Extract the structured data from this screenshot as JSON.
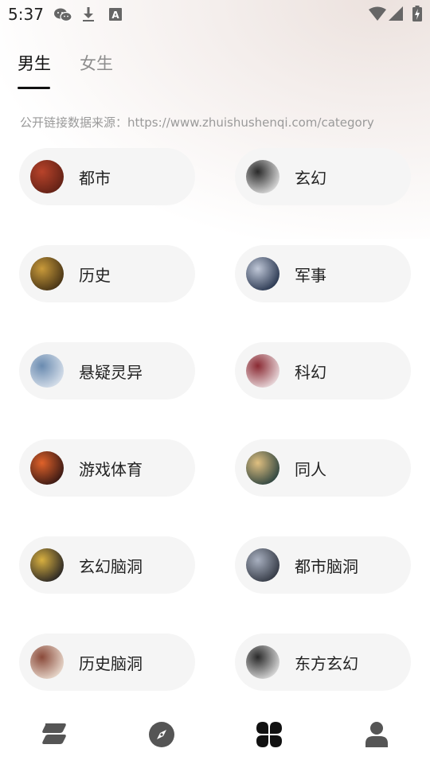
{
  "status_bar": {
    "time": "5:37",
    "icons": [
      "wechat-icon",
      "download-icon",
      "font-a-icon",
      "wifi-icon",
      "signal-icon",
      "battery-charging-icon"
    ]
  },
  "tabs": [
    {
      "label": "男生",
      "active": true
    },
    {
      "label": "女生",
      "active": false
    }
  ],
  "source_text": "公开链接数据来源：https://www.zhuishushenqi.com/category",
  "categories": [
    {
      "label": "都市",
      "thumb": [
        "#5a1e14",
        "#b8432a"
      ]
    },
    {
      "label": "玄幻",
      "thumb": [
        "#e8e8e8",
        "#2a2a2a"
      ]
    },
    {
      "label": "历史",
      "thumb": [
        "#3b2a12",
        "#c99a3a"
      ]
    },
    {
      "label": "军事",
      "thumb": [
        "#1c2a44",
        "#c0c8d8"
      ]
    },
    {
      "label": "悬疑灵异",
      "thumb": [
        "#dfe6ef",
        "#6a8bb0"
      ]
    },
    {
      "label": "科幻",
      "thumb": [
        "#f1e8ea",
        "#8a2a33"
      ]
    },
    {
      "label": "游戏体育",
      "thumb": [
        "#2a1212",
        "#e0622a"
      ]
    },
    {
      "label": "同人",
      "thumb": [
        "#1f3a3a",
        "#e0c080"
      ]
    },
    {
      "label": "玄幻脑洞",
      "thumb": [
        "#1a1a22",
        "#d8b040"
      ]
    },
    {
      "label": "都市脑洞",
      "thumb": [
        "#2a2f3a",
        "#a8b0c0"
      ]
    },
    {
      "label": "历史脑洞",
      "thumb": [
        "#f0e4d8",
        "#8a4a3a"
      ]
    },
    {
      "label": "东方玄幻",
      "thumb": [
        "#e8e8e8",
        "#2a2a2a"
      ]
    }
  ],
  "bottom_nav": [
    {
      "name": "bookshelf-nav",
      "icon": "stack-icon",
      "active": false
    },
    {
      "name": "discover-nav",
      "icon": "compass-icon",
      "active": false
    },
    {
      "name": "category-nav",
      "icon": "category-grid-icon",
      "active": true
    },
    {
      "name": "profile-nav",
      "icon": "person-icon",
      "active": false
    }
  ],
  "colors": {
    "active_text": "#111111",
    "inactive_text": "#8d8d8d",
    "pill_bg": "#f5f5f5",
    "nav_icon": "#555555",
    "nav_icon_active": "#111111"
  }
}
